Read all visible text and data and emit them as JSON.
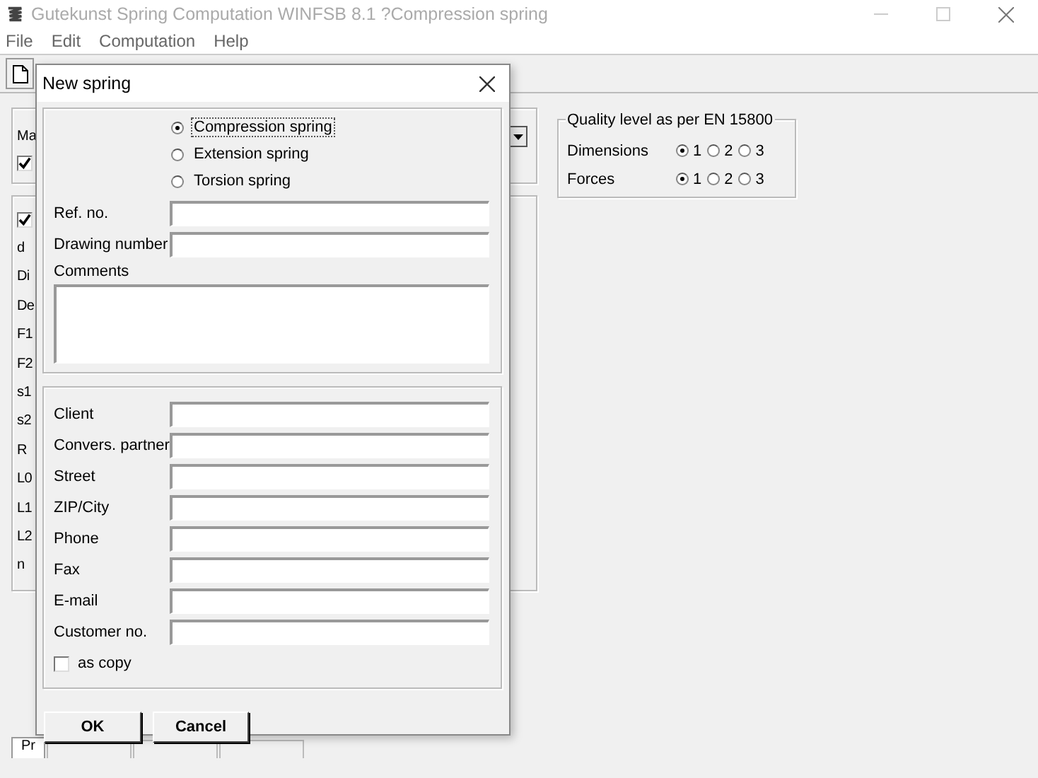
{
  "window": {
    "title": "Gutekunst Spring Computation WINFSB 8.1 ?Compression spring"
  },
  "menu": [
    "File",
    "Edit",
    "Computation",
    "Help"
  ],
  "background": {
    "group_label": "Ma",
    "checkboxes": [
      {
        "checked": true
      },
      {
        "checked": true
      }
    ],
    "variables": [
      "d",
      "Di",
      "De",
      "F1",
      "F2",
      "s1",
      "s2",
      "R",
      "L0",
      "L1",
      "L2",
      "n"
    ],
    "quality": {
      "title": "Quality level as per EN 15800",
      "rows": [
        {
          "label": "Dimensions",
          "options": [
            {
              "label": "1",
              "selected": true
            },
            {
              "label": "2",
              "selected": false
            },
            {
              "label": "3",
              "selected": false
            }
          ]
        },
        {
          "label": "Forces",
          "options": [
            {
              "label": "1",
              "selected": true
            },
            {
              "label": "2",
              "selected": false
            },
            {
              "label": "3",
              "selected": false
            }
          ]
        }
      ]
    },
    "tabs": [
      {
        "label": "Pr",
        "selected": true
      }
    ]
  },
  "dialog": {
    "title": "New spring",
    "spring_types": [
      {
        "label": "Compression spring",
        "selected": true
      },
      {
        "label": "Extension spring",
        "selected": false
      },
      {
        "label": "Torsion spring",
        "selected": false
      }
    ],
    "fields": [
      {
        "label": "Ref. no.",
        "kind": "line"
      },
      {
        "label": "Drawing number",
        "kind": "line"
      },
      {
        "label": "Comments",
        "kind": "area"
      }
    ],
    "contact_fields": [
      "Client",
      "Convers. partner",
      "Street",
      "ZIP/City",
      "Phone",
      "Fax",
      "E-mail",
      "Customer no."
    ],
    "as_copy": {
      "label": "as copy",
      "checked": false
    },
    "buttons": [
      "OK",
      "Cancel"
    ]
  }
}
